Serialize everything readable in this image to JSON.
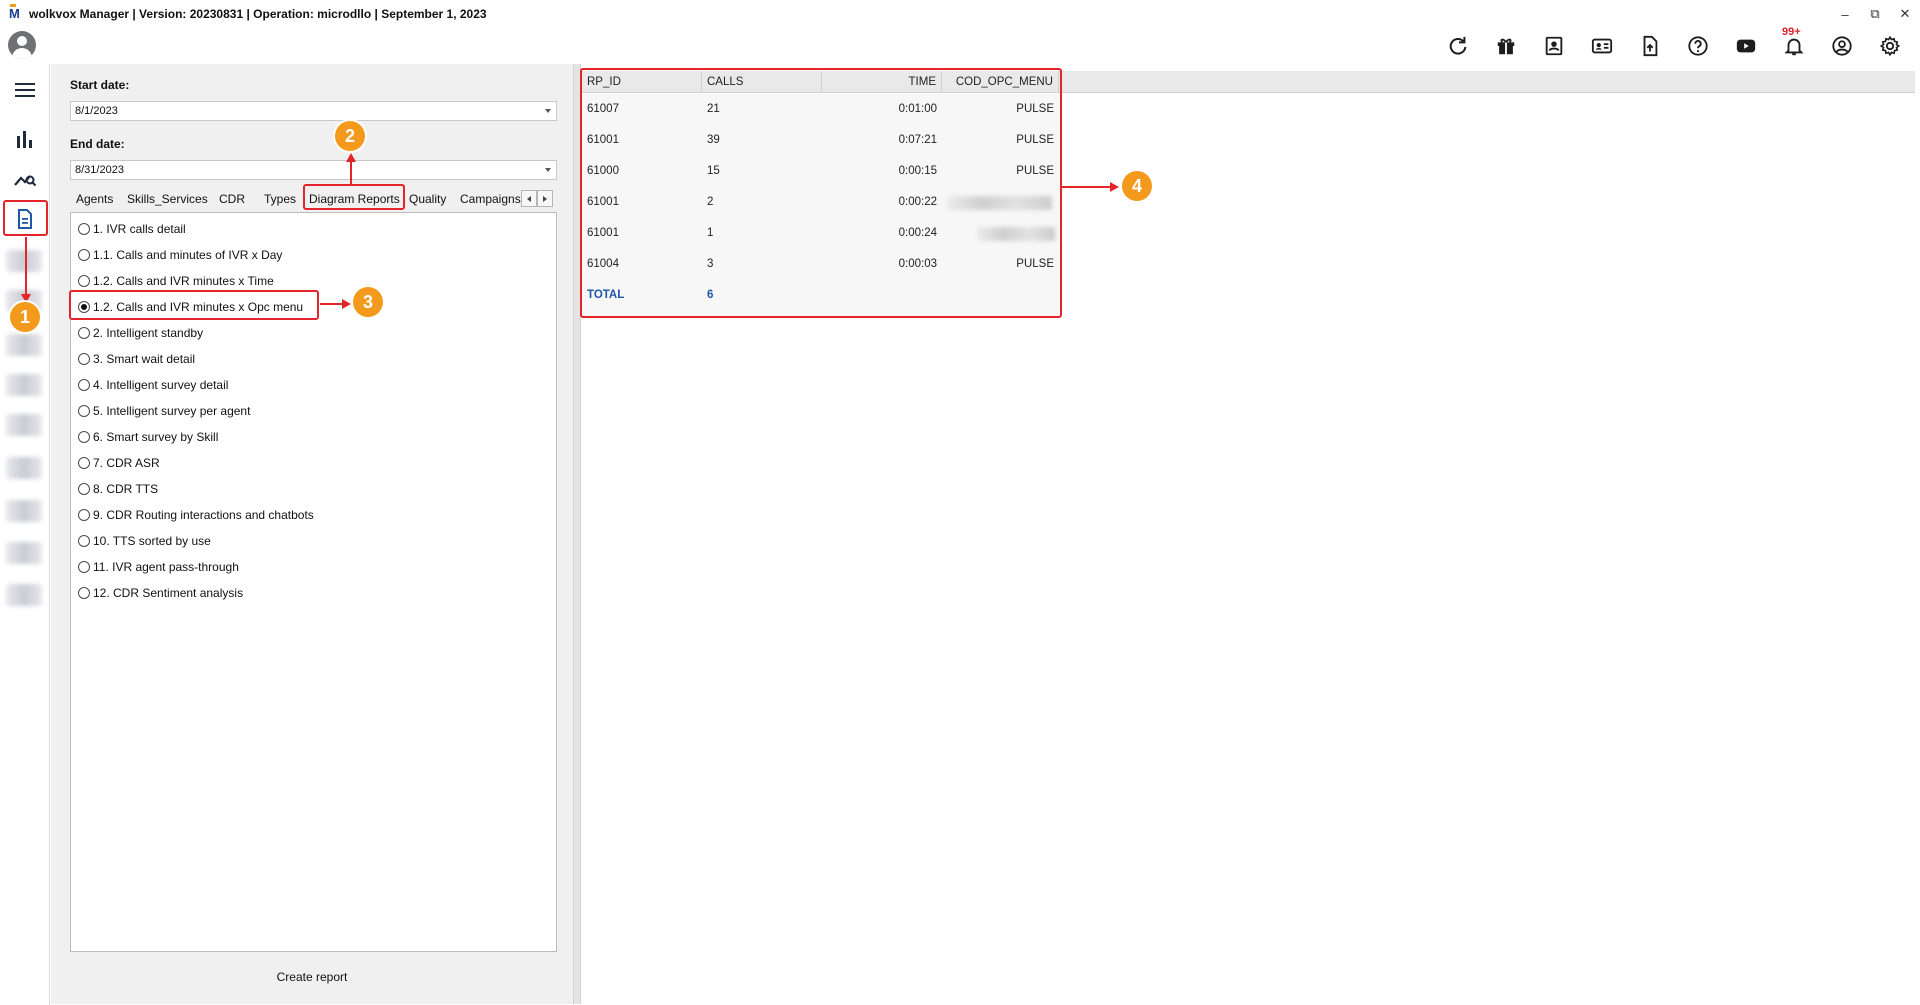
{
  "window": {
    "title": "wolkvox Manager  | Version: 20230831 |  Operation: microdllo | September 1, 2023",
    "controls": [
      "minimize",
      "restore",
      "close"
    ]
  },
  "header": {
    "icons": [
      "refresh-icon",
      "gift-icon",
      "contacts-book-icon",
      "id-card-icon",
      "upload-file-icon",
      "help-icon",
      "youtube-icon",
      "bell-icon",
      "account-icon",
      "gear-icon"
    ],
    "notification_count": "99+"
  },
  "nav": {
    "icons": [
      "hamburger-menu-icon",
      "bar-chart-icon",
      "analytics-icon",
      "reports-icon"
    ]
  },
  "filters": {
    "start_date_label": "Start date:",
    "start_date_value": "8/1/2023",
    "end_date_label": "End date:",
    "end_date_value": "8/31/2023"
  },
  "tabs": [
    {
      "label": "Agents"
    },
    {
      "label": "Skills_Services"
    },
    {
      "label": "CDR"
    },
    {
      "label": "Types"
    },
    {
      "label": "Diagram Reports"
    },
    {
      "label": "Quality"
    },
    {
      "label": "Campaigns"
    }
  ],
  "reports": [
    {
      "label": "1. IVR calls detail"
    },
    {
      "label": "1.1. Calls and minutes of IVR x Day"
    },
    {
      "label": "1.2. Calls and IVR minutes x Time"
    },
    {
      "label": "1.2. Calls and IVR minutes x Opc menu"
    },
    {
      "label": "2. Intelligent standby"
    },
    {
      "label": "3. Smart wait detail"
    },
    {
      "label": "4. Intelligent survey detail"
    },
    {
      "label": "5. Intelligent survey per agent"
    },
    {
      "label": "6. Smart survey by Skill"
    },
    {
      "label": "7. CDR ASR"
    },
    {
      "label": "8. CDR TTS"
    },
    {
      "label": "9. CDR Routing interactions and chatbots"
    },
    {
      "label": "10. TTS sorted by use"
    },
    {
      "label": "11. IVR agent pass-through"
    },
    {
      "label": "12. CDR Sentiment analysis"
    }
  ],
  "create_report_label": "Create report",
  "grid": {
    "columns": [
      "RP_ID",
      "CALLS",
      "TIME",
      "COD_OPC_MENU"
    ],
    "rows": [
      {
        "rp_id": "61007",
        "calls": "21",
        "time": "0:01:00",
        "menu": "PULSE"
      },
      {
        "rp_id": "61001",
        "calls": "39",
        "time": "0:07:21",
        "menu": "PULSE"
      },
      {
        "rp_id": "61000",
        "calls": "15",
        "time": "0:00:15",
        "menu": "PULSE"
      },
      {
        "rp_id": "61001",
        "calls": "2",
        "time": "0:00:22",
        "menu": ""
      },
      {
        "rp_id": "61001",
        "calls": "1",
        "time": "0:00:24",
        "menu": ""
      },
      {
        "rp_id": "61004",
        "calls": "3",
        "time": "0:00:03",
        "menu": "PULSE"
      }
    ],
    "total_label": "TOTAL",
    "total_calls": "6"
  },
  "annotations": {
    "step1": "1",
    "step2": "2",
    "step3": "3",
    "step4": "4",
    "highlight_color": "#e3242b",
    "badge_color": "#f39a1d"
  }
}
